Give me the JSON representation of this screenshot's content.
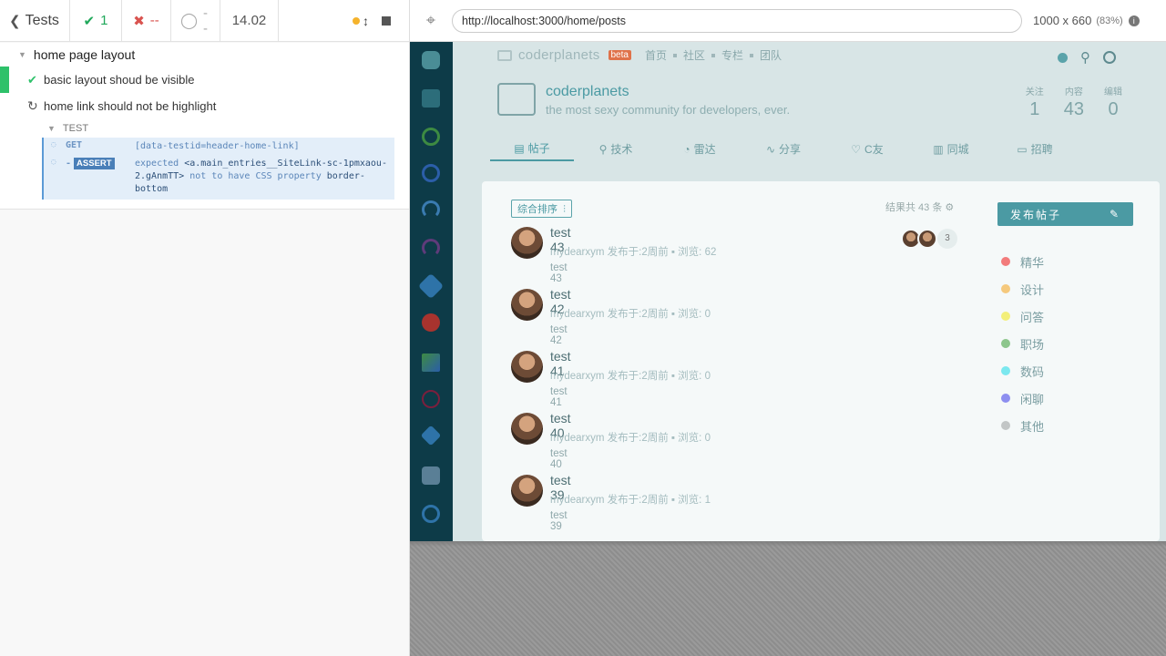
{
  "reporter": {
    "back_label": "Tests",
    "passed": "1",
    "failed": "--",
    "pending": "--",
    "duration": "14.02"
  },
  "runner": {
    "suite_title": "home page layout",
    "tests": [
      {
        "title": "basic layout shoud be visible",
        "state": "passed"
      },
      {
        "title": "home link should not be highlight",
        "state": "running"
      }
    ],
    "section_label": "TEST",
    "commands": [
      {
        "name": "GET",
        "message": "[data-testid=header-home-link]"
      },
      {
        "name": "ASSERT",
        "prefix": "-",
        "message_parts": {
          "expected": "expected",
          "subject": "<a.main_entries__SiteLink-sc-1pmxaou-2.gAnmTT>",
          "not_css": "not to have CSS property",
          "prop": "border-bottom"
        }
      }
    ]
  },
  "aut": {
    "url": "http://localhost:3000/home/posts",
    "viewport": "1000 x 660",
    "scale": "(83%)"
  },
  "site": {
    "brand": "coderplanets",
    "beta": "beta",
    "nav": [
      "首页",
      "社区",
      "专栏",
      "团队"
    ],
    "community_title": "coderplanets",
    "community_desc": "the most sexy community for developers, ever.",
    "stats": [
      {
        "label": "关注",
        "value": "1"
      },
      {
        "label": "内容",
        "value": "43"
      },
      {
        "label": "编辑",
        "value": "0"
      }
    ],
    "tabs": [
      "帖子",
      "技术",
      "雷达",
      "分享",
      "C友",
      "同城",
      "招聘"
    ],
    "sort_label": "综合排序",
    "total_label": "结果共 43 条",
    "active_users_count": "3",
    "publish_label": "发布帖子",
    "posts": [
      {
        "title": "test 43",
        "meta": "mydearxym 发布于:2周前 ▪ 浏览: 62",
        "body": "test 43"
      },
      {
        "title": "test 42",
        "meta": "mydearxym 发布于:2周前 ▪ 浏览: 0",
        "body": "test 42"
      },
      {
        "title": "test 41",
        "meta": "mydearxym 发布于:2周前 ▪ 浏览: 0",
        "body": "test 41"
      },
      {
        "title": "test 40",
        "meta": "mydearxym 发布于:2周前 ▪ 浏览: 0",
        "body": "test 40"
      },
      {
        "title": "test 39",
        "meta": "mydearxym 发布于:2周前 ▪ 浏览: 1",
        "body": "test 39"
      }
    ],
    "tags": [
      {
        "label": "精华",
        "color": "#f27b7b"
      },
      {
        "label": "设计",
        "color": "#f5c97d"
      },
      {
        "label": "问答",
        "color": "#f3ef7a"
      },
      {
        "label": "职场",
        "color": "#8cc68c"
      },
      {
        "label": "数码",
        "color": "#7be8ef"
      },
      {
        "label": "闲聊",
        "color": "#8d8ff0"
      },
      {
        "label": "其他",
        "color": "#c2c6c6"
      }
    ]
  }
}
